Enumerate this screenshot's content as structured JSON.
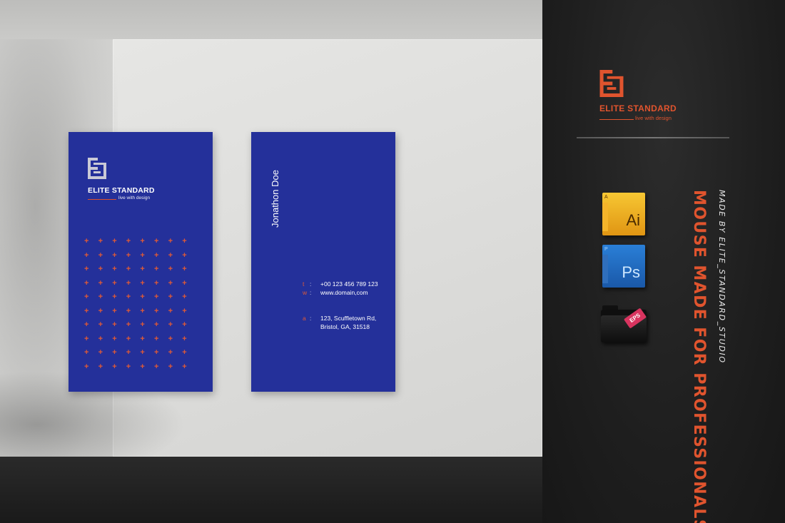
{
  "front_card": {
    "brand": "ELITE STANDARD",
    "tagline": "live with design",
    "pattern_glyph": "+",
    "pattern_rows": 10,
    "pattern_cols": 8
  },
  "back_card": {
    "name": "Jonathon Doe",
    "contacts": [
      {
        "key": "t",
        "value": "+00 123 456 789 123"
      },
      {
        "key": "w",
        "value": "www.domain,com"
      }
    ],
    "address": {
      "key": "a",
      "lines": [
        "123, Scuffletown Rd,",
        "Bristol, GA, 31518"
      ]
    }
  },
  "panel": {
    "brand": "ELITE STANDARD",
    "tagline": "live with design",
    "headline": "MOUSE MADE FOR PROFESSIONALS",
    "credit": "MADE BY ELITE_STANDARD_STUDIO",
    "file_icons": [
      {
        "name": "illustrator-icon",
        "label": "Ai"
      },
      {
        "name": "photoshop-icon",
        "label": "Ps"
      },
      {
        "name": "eps-folder-icon",
        "label": "EPS"
      }
    ]
  },
  "colors": {
    "card_blue": "#24309a",
    "accent_orange": "#e0542e",
    "panel_dark": "#1e1e1e",
    "eps_tag": "#d8345f"
  }
}
